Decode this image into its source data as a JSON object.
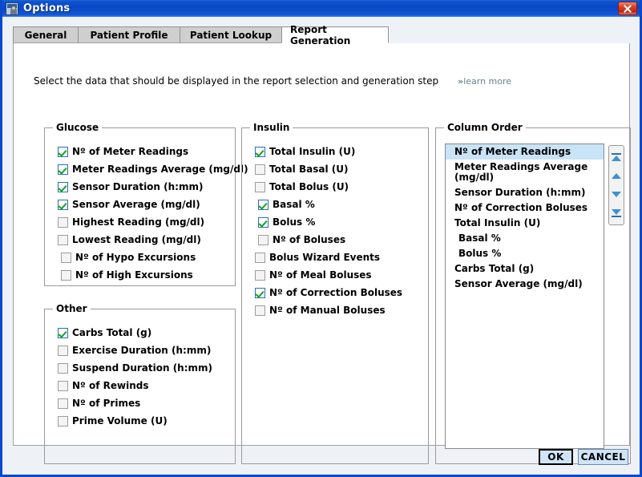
{
  "window": {
    "title": "Options",
    "icon": "app-icon",
    "close_icon": "close-icon",
    "accent_blue": "#0b47c4",
    "client_bg": "#eef2f7"
  },
  "tabs": [
    {
      "label": "General",
      "active": false
    },
    {
      "label": "Patient Profile",
      "active": false
    },
    {
      "label": "Patient Lookup",
      "active": false
    },
    {
      "label": "Report Generation",
      "active": true
    }
  ],
  "hint": {
    "text": "Select the data that should be displayed in the report selection and generation step",
    "learn_more_chevron": "»",
    "learn_more_label": "learn more",
    "learn_more_color": "#68818c"
  },
  "groups": {
    "glucose": {
      "legend": "Glucose",
      "items": [
        {
          "label": "Nº of Meter Readings",
          "checked": true,
          "indent": false
        },
        {
          "label": "Meter Readings Average (mg/dl)",
          "checked": true,
          "indent": false
        },
        {
          "label": "Sensor Duration (h:mm)",
          "checked": true,
          "indent": false
        },
        {
          "label": "Sensor Average (mg/dl)",
          "checked": true,
          "indent": false
        },
        {
          "label": "Highest Reading (mg/dl)",
          "checked": false,
          "indent": false
        },
        {
          "label": "Lowest Reading (mg/dl)",
          "checked": false,
          "indent": false
        },
        {
          "label": "Nº of Hypo Excursions",
          "checked": false,
          "indent": true
        },
        {
          "label": "Nº of High Excursions",
          "checked": false,
          "indent": true
        }
      ]
    },
    "other": {
      "legend": "Other",
      "items": [
        {
          "label": "Carbs Total (g)",
          "checked": true,
          "indent": false
        },
        {
          "label": "Exercise Duration (h:mm)",
          "checked": false,
          "indent": false
        },
        {
          "label": "Suspend Duration (h:mm)",
          "checked": false,
          "indent": false
        },
        {
          "label": "Nº of Rewinds",
          "checked": false,
          "indent": false
        },
        {
          "label": "Nº of Primes",
          "checked": false,
          "indent": false
        },
        {
          "label": "Prime Volume (U)",
          "checked": false,
          "indent": false
        }
      ]
    },
    "insulin": {
      "legend": "Insulin",
      "items": [
        {
          "label": "Total Insulin (U)",
          "checked": true,
          "indent": false
        },
        {
          "label": "Total Basal (U)",
          "checked": false,
          "indent": false
        },
        {
          "label": "Total Bolus (U)",
          "checked": false,
          "indent": false
        },
        {
          "label": "Basal %",
          "checked": true,
          "indent": true
        },
        {
          "label": "Bolus %",
          "checked": true,
          "indent": true
        },
        {
          "label": "Nº of Boluses",
          "checked": false,
          "indent": true
        },
        {
          "label": "Bolus Wizard Events",
          "checked": false,
          "indent": false
        },
        {
          "label": "Nº of Meal Boluses",
          "checked": false,
          "indent": false
        },
        {
          "label": "Nº of Correction Boluses",
          "checked": true,
          "indent": false
        },
        {
          "label": "Nº of Manual Boluses",
          "checked": false,
          "indent": false
        }
      ]
    },
    "column_order": {
      "legend": "Column Order",
      "selected_index": 0,
      "highlight_color": "#c9e3f7",
      "items": [
        {
          "label": "Nº of Meter Readings",
          "indent": false
        },
        {
          "label": "Meter Readings Average (mg/dl)",
          "indent": false
        },
        {
          "label": "Sensor Duration (h:mm)",
          "indent": false
        },
        {
          "label": "Nº of Correction Boluses",
          "indent": false
        },
        {
          "label": "Total Insulin (U)",
          "indent": false
        },
        {
          "label": "Basal %",
          "indent": true
        },
        {
          "label": "Bolus %",
          "indent": true
        },
        {
          "label": "Carbs Total (g)",
          "indent": false
        },
        {
          "label": "Sensor Average (mg/dl)",
          "indent": false
        }
      ],
      "order_buttons": [
        {
          "icon": "move-to-top-icon"
        },
        {
          "icon": "move-up-icon"
        },
        {
          "icon": "move-down-icon"
        },
        {
          "icon": "move-to-bottom-icon"
        }
      ]
    }
  },
  "footer": {
    "ok_label": "OK",
    "cancel_label": "CANCEL"
  }
}
